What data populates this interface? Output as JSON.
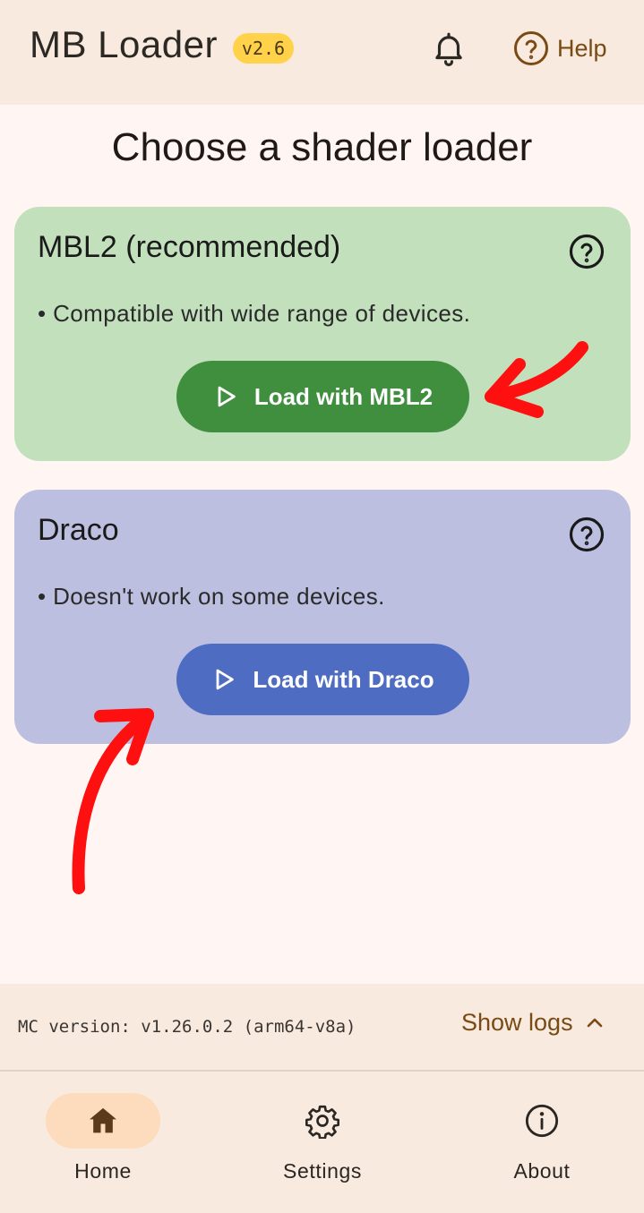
{
  "header": {
    "app_title": "MB Loader",
    "version_badge": "v2.6",
    "notifications_icon": "bell-icon",
    "help_label": "Help",
    "help_icon": "question-circle-icon"
  },
  "main": {
    "heading": "Choose a shader loader",
    "loaders": [
      {
        "title": "MBL2 (recommended)",
        "description": "• Compatible with wide range of devices.",
        "button_label": "Load with MBL2",
        "card_color": "#c3e0bd",
        "button_color": "#3f8f3f"
      },
      {
        "title": "Draco",
        "description": "• Doesn't work on some devices.",
        "button_label": "Load with Draco",
        "card_color": "#bcbfe0",
        "button_color": "#4e6cc2"
      }
    ]
  },
  "status_bar": {
    "mc_version": "MC version: v1.26.0.2 (arm64-v8a)",
    "show_logs_label": "Show logs"
  },
  "bottom_nav": {
    "items": [
      {
        "label": "Home",
        "icon": "home-icon",
        "active": true
      },
      {
        "label": "Settings",
        "icon": "gear-icon",
        "active": false
      },
      {
        "label": "About",
        "icon": "info-icon",
        "active": false
      }
    ]
  },
  "annotation_color": "#ff1010"
}
